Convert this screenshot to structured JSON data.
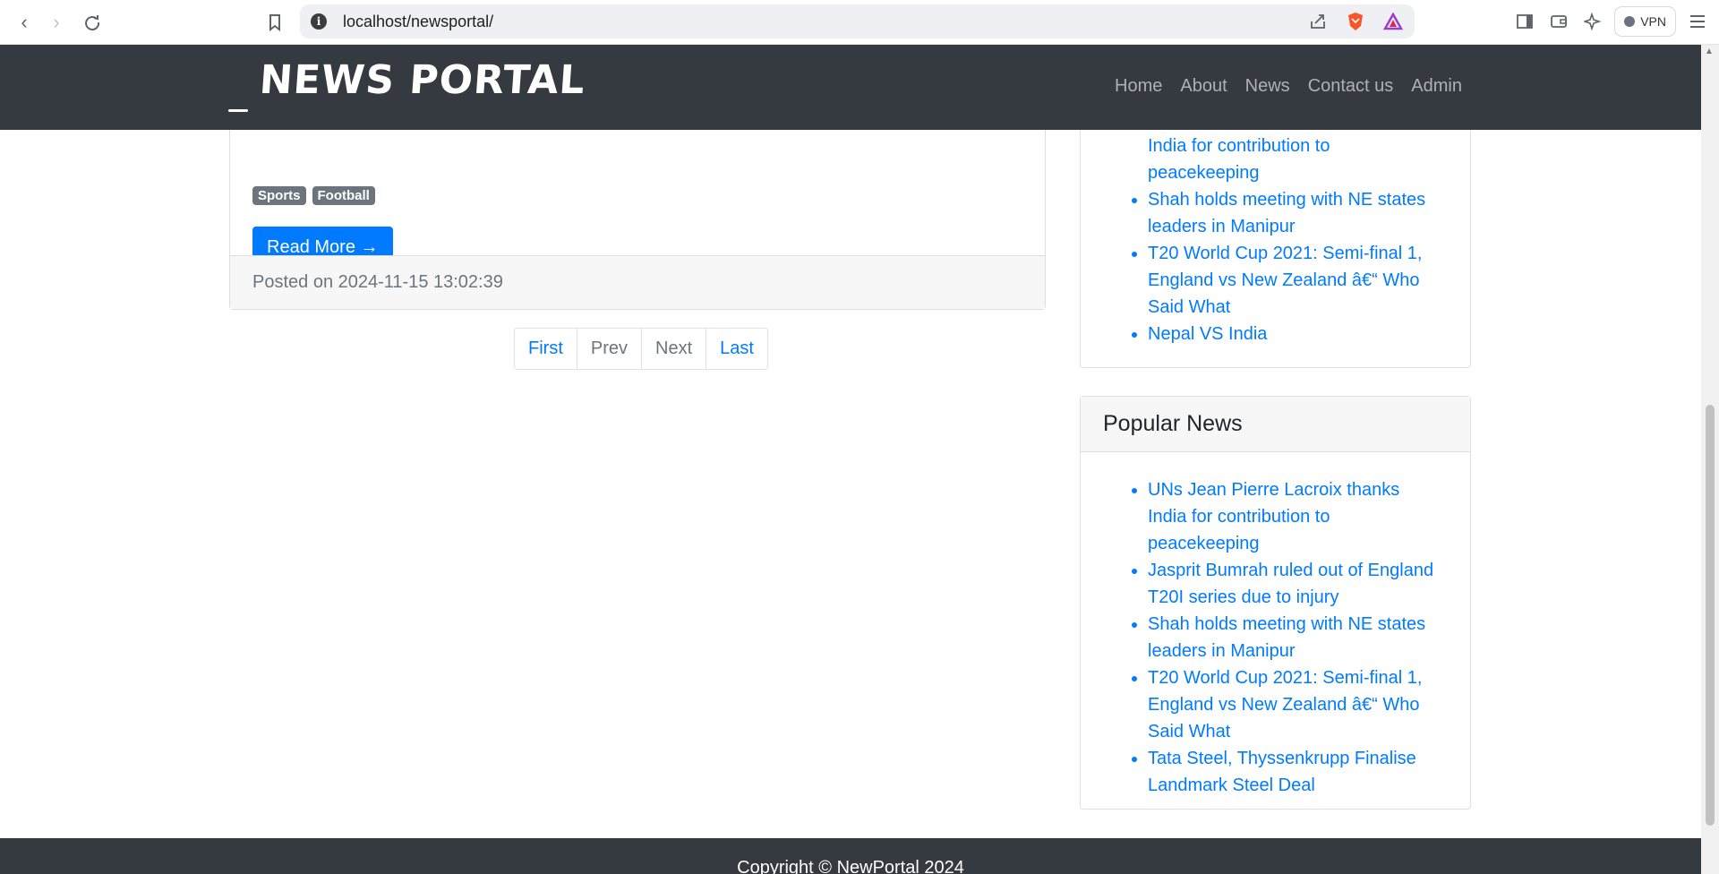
{
  "browser": {
    "url": "localhost/newsportal/",
    "vpn_label": "VPN"
  },
  "site": {
    "logo": "NEWS PORTAL",
    "menu": [
      "Home",
      "About",
      "News",
      "Contact us",
      "Admin"
    ]
  },
  "post": {
    "tags": [
      "Sports",
      "Football"
    ],
    "read_more": "Read More →",
    "posted": "Posted on 2024-11-15 13:02:39"
  },
  "pagination": [
    "First",
    "Prev",
    "Next",
    "Last"
  ],
  "sidebar": {
    "recent_items": [
      "UNs Jean Pierre Lacroix thanks India for contribution to peacekeeping",
      "Shah holds meeting with NE states leaders in Manipur",
      "T20 World Cup 2021: Semi-final 1, England vs New Zealand â€“ Who Said What",
      "Nepal VS India"
    ],
    "popular_title": "Popular News",
    "popular_items": [
      "UNs Jean Pierre Lacroix thanks India for contribution to peacekeeping",
      "Jasprit Bumrah ruled out of England T20I series due to injury",
      "Shah holds meeting with NE states leaders in Manipur",
      "T20 World Cup 2021: Semi-final 1, England vs New Zealand â€“ Who Said What",
      "Tata Steel, Thyssenkrupp Finalise Landmark Steel Deal"
    ]
  },
  "footer": {
    "copyright": "Copyright © NewPortal 2024"
  }
}
